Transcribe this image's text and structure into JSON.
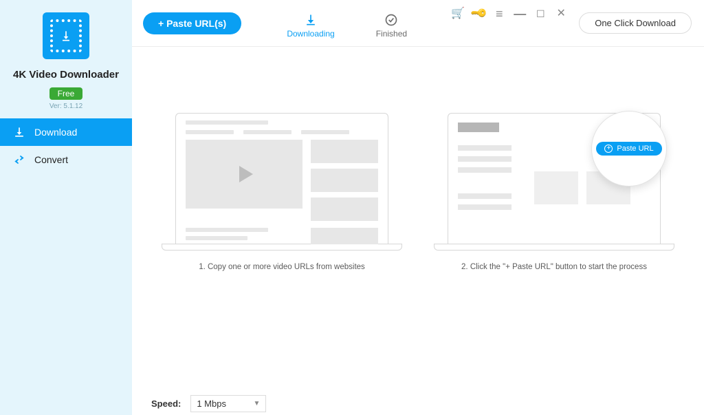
{
  "sidebar": {
    "app_name": "4K Video Downloader",
    "plan_badge": "Free",
    "version": "Ver: 5.1.12",
    "items": [
      {
        "label": "Download"
      },
      {
        "label": "Convert"
      }
    ]
  },
  "topbar": {
    "paste_button": "+ Paste URL(s)",
    "tabs": {
      "downloading": "Downloading",
      "finished": "Finished"
    },
    "one_click": "One Click Download"
  },
  "content": {
    "step1_caption": "1. Copy one or more video URLs from websites",
    "step2_caption": "2. Click the \"+ Paste URL\" button to start the process",
    "magnifier_label": "Paste URL"
  },
  "footer": {
    "speed_label": "Speed:",
    "speed_value": "1 Mbps"
  }
}
